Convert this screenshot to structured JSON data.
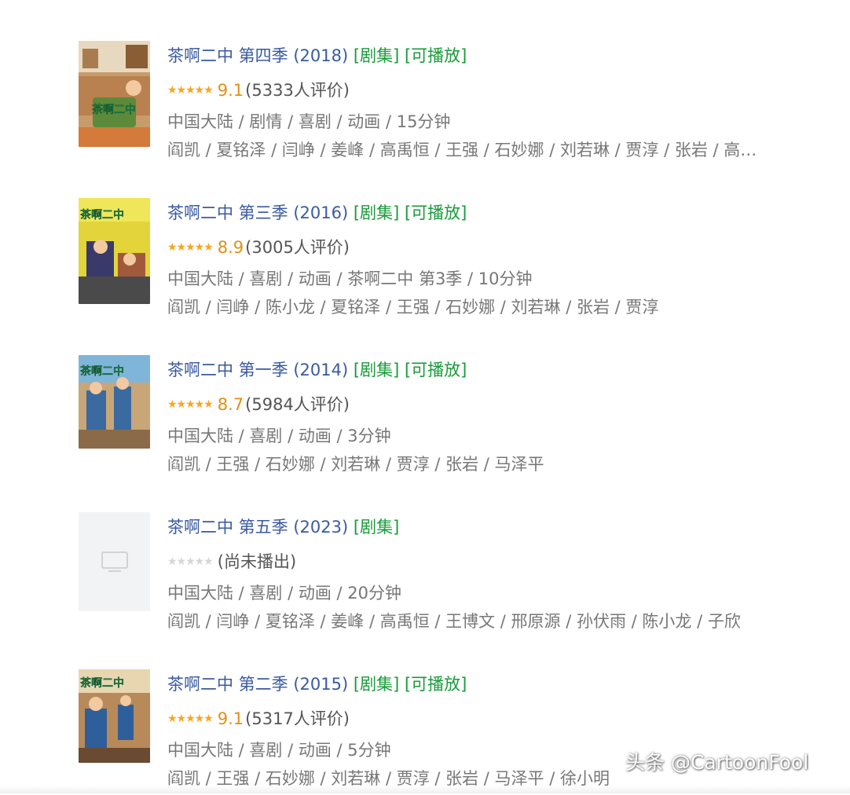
{
  "results": [
    {
      "title": "茶啊二中 第四季 (2018)",
      "tag_series": "[剧集]",
      "tag_playable": "[可播放]",
      "stars": "★★★★★",
      "score": "9.1",
      "votes": "(5333人评价)",
      "meta": "中国大陆 / 剧情 / 喜剧 / 动画 / 15分钟",
      "cast": "阎凯 / 夏铭泽 / 闫峥 / 姜峰 / 高禹恒 / 王强 / 石妙娜 / 刘若琳 / 贾淳 / 张岩 / 高…",
      "poster_text": "茶啊二中"
    },
    {
      "title": "茶啊二中 第三季 (2016)",
      "tag_series": "[剧集]",
      "tag_playable": "[可播放]",
      "stars": "★★★★★",
      "score": "8.9",
      "votes": "(3005人评价)",
      "meta": "中国大陆 / 喜剧 / 动画 / 茶啊二中 第3季 / 10分钟",
      "cast": "阎凯 / 闫峥 / 陈小龙 / 夏铭泽 / 王强 / 石妙娜 / 刘若琳 / 张岩 / 贾淳",
      "poster_text": "茶啊二中"
    },
    {
      "title": "茶啊二中 第一季 (2014)",
      "tag_series": "[剧集]",
      "tag_playable": "[可播放]",
      "stars": "★★★★★",
      "score": "8.7",
      "votes": "(5984人评价)",
      "meta": "中国大陆 / 喜剧 / 动画 / 3分钟",
      "cast": "阎凯 / 王强 / 石妙娜 / 刘若琳 / 贾淳 / 张岩 / 马泽平",
      "poster_text": "茶啊二中"
    },
    {
      "title": "茶啊二中 第五季 (2023)",
      "tag_series": "[剧集]",
      "tag_playable": "",
      "stars": "★★★★★",
      "score": "",
      "votes": "(尚未播出)",
      "meta": "中国大陆 / 喜剧 / 动画 / 20分钟",
      "cast": "阎凯 / 闫峥 / 夏铭泽 / 姜峰 / 高禹恒 / 王博文 / 邢原源 / 孙伏雨 / 陈小龙 / 子欣",
      "poster_text": ""
    },
    {
      "title": "茶啊二中 第二季 (2015)",
      "tag_series": "[剧集]",
      "tag_playable": "[可播放]",
      "stars": "★★★★★",
      "score": "9.1",
      "votes": "(5317人评价)",
      "meta": "中国大陆 / 喜剧 / 动画 / 5分钟",
      "cast": "阎凯 / 王强 / 石妙娜 / 刘若琳 / 贾淳 / 张岩 / 马泽平 / 徐小明",
      "poster_text": "茶啊二中"
    }
  ],
  "watermark": "头条 @CartoonFool",
  "colors": {
    "title": "#3a5aa0",
    "tag": "#1a9b3a",
    "star": "#f6a623",
    "score": "#e09015"
  }
}
